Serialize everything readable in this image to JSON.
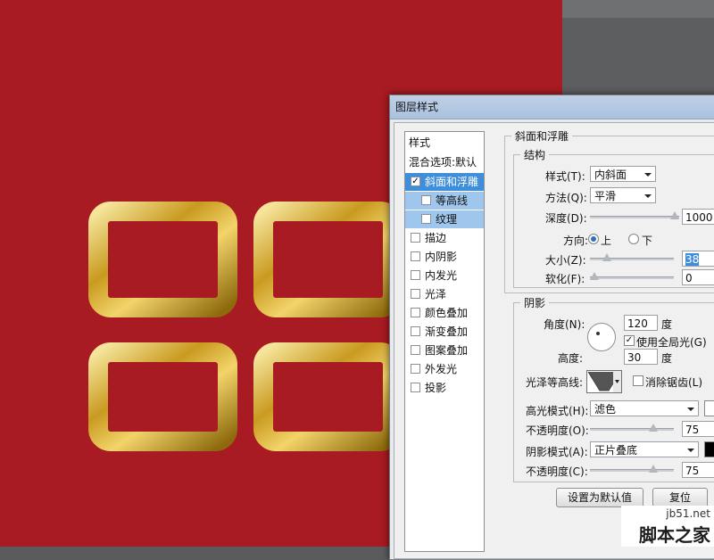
{
  "dialog": {
    "title": "图层样式"
  },
  "styles_panel": {
    "header": "样式",
    "blend_options": "混合选项:默认",
    "items": [
      {
        "label": "斜面和浮雕",
        "checked": true,
        "selected": true
      },
      {
        "label": "等高线",
        "checked": false,
        "sub": true
      },
      {
        "label": "纹理",
        "checked": false,
        "sub": true
      },
      {
        "label": "描边",
        "checked": false
      },
      {
        "label": "内阴影",
        "checked": false
      },
      {
        "label": "内发光",
        "checked": false
      },
      {
        "label": "光泽",
        "checked": false
      },
      {
        "label": "颜色叠加",
        "checked": false
      },
      {
        "label": "渐变叠加",
        "checked": false
      },
      {
        "label": "图案叠加",
        "checked": false
      },
      {
        "label": "外发光",
        "checked": false
      },
      {
        "label": "投影",
        "checked": false
      }
    ]
  },
  "bevel": {
    "section_title": "斜面和浮雕",
    "structure_title": "结构",
    "style_label": "样式(T):",
    "style_value": "内斜面",
    "technique_label": "方法(Q):",
    "technique_value": "平滑",
    "depth_label": "深度(D):",
    "depth_value": "1000",
    "depth_fraction": 0.97,
    "direction_label": "方向:",
    "direction_up": "上",
    "direction_down": "下",
    "size_label": "大小(Z):",
    "size_value": "38",
    "size_fraction": 0.2,
    "soften_label": "软化(F):",
    "soften_value": "0",
    "soften_fraction": 0.0
  },
  "shading": {
    "title": "阴影",
    "angle_label": "角度(N):",
    "angle_value": "120",
    "degree_unit": "度",
    "global_light_label": "使用全局光(G)",
    "altitude_label": "高度:",
    "altitude_value": "30",
    "gloss_label": "光泽等高线:",
    "antialias_label": "消除锯齿(L)",
    "highlight_mode_label": "高光模式(H):",
    "highlight_mode_value": "滤色",
    "highlight_opacity_label": "不透明度(O):",
    "highlight_opacity_value": "75",
    "highlight_opacity_fraction": 0.75,
    "shadow_mode_label": "阴影模式(A):",
    "shadow_mode_value": "正片叠底",
    "shadow_opacity_label": "不透明度(C):",
    "shadow_opacity_value": "75",
    "shadow_opacity_fraction": 0.75
  },
  "buttons": {
    "set_default": "设置为默认值",
    "reset": "复位"
  },
  "watermark": {
    "site": "jb51.net",
    "name": "脚本之家"
  },
  "colors": {
    "canvas": "#a81b22",
    "gold": "#d8b23a",
    "highlight_swatch": "#ffffff",
    "shadow_swatch": "#000000"
  }
}
